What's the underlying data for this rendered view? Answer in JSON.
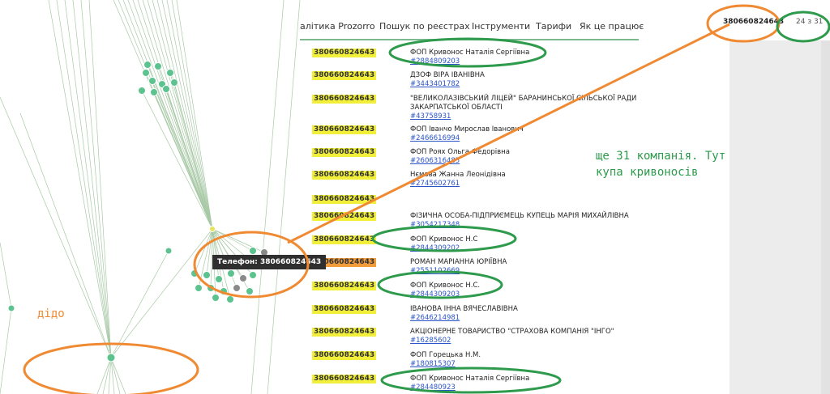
{
  "nav": {
    "items": [
      "алітика Prozorro",
      "Пошук по реєстрах",
      "Інструменти",
      "Тарифи",
      "Як це працює"
    ]
  },
  "header": {
    "phone": "380660824643",
    "counter": "24 з 31"
  },
  "tooltip": {
    "text": "Телефон: 380660824643"
  },
  "rows": [
    {
      "phone": "380660824643",
      "name": [
        "ФОП Кривонос Наталія Сергіївна"
      ],
      "link": "#2884809203",
      "highlight": "yellow"
    },
    {
      "phone": "380660824643",
      "name": [
        "ДЗОФ ВІРА ІВАНІВНА"
      ],
      "link": "#3443401782",
      "highlight": "yellow"
    },
    {
      "phone": "380660824643",
      "name": [
        "\"ВЕЛИКОЛАЗІВСЬКИЙ ЛІЦЕЙ\" БАРАНИНСЬКОЇ СІЛЬСЬКОЇ РАДИ",
        "ЗАКАРПАТСЬКОЇ ОБЛАСТІ"
      ],
      "link": "#43758931",
      "highlight": "yellow"
    },
    {
      "phone": "380660824643",
      "name": [
        "ФОП Іванчо Мирослав Іванович"
      ],
      "link": "#2466616994",
      "highlight": "yellow"
    },
    {
      "phone": "380660824643",
      "name": [
        "ФОП Роях Ольга Федорівна"
      ],
      "link": "#2606316485",
      "highlight": "yellow"
    },
    {
      "phone": "380660824643",
      "name": [
        "Нємова Жанна Леонідівна"
      ],
      "link": "#2745602761",
      "highlight": "yellow"
    },
    {
      "phone": "380660824643",
      "name": [],
      "link": "",
      "highlight": "yellow"
    },
    {
      "phone": "380660824643",
      "name": [
        "ФІЗИЧНА ОСОБА-ПІДПРИЄМЕЦЬ КУПЕЦЬ МАРІЯ МИХАЙЛІВНА"
      ],
      "link": "#3054217348",
      "highlight": "yellow"
    },
    {
      "phone": "380660824643",
      "name": [
        "ФОП Кривонос Н.С"
      ],
      "link": "#2844309202",
      "highlight": "yellow"
    },
    {
      "phone": "380660824643",
      "name": [
        "РОМАН МАРІАННА ЮРІЇВНА"
      ],
      "link": "#2551102669",
      "highlight": "orange"
    },
    {
      "phone": "380660824643",
      "name": [
        "ФОП Кривонос Н.С."
      ],
      "link": "#2844309203",
      "highlight": "yellow"
    },
    {
      "phone": "380660824643",
      "name": [
        "ІВАНОВА ІННА ВЯЧЕСЛАВІВНА"
      ],
      "link": "#2646214981",
      "highlight": "yellow"
    },
    {
      "phone": "380660824643",
      "name": [
        "АКЦІОНЕРНЕ ТОВАРИСТВО \"СТРАХОВА КОМПАНІЯ \"ІНГО\""
      ],
      "link": "#16285602",
      "highlight": "yellow"
    },
    {
      "phone": "380660824643",
      "name": [
        "ФОП Горецька Н.М."
      ],
      "link": "#180815307",
      "highlight": "yellow"
    },
    {
      "phone": "380660824643",
      "name": [
        "ФОП Кривонос Наталія Сергіївна"
      ],
      "link": "#284480923",
      "highlight": "yellow"
    }
  ],
  "annotations": {
    "note": "ще 31 компанія. Тут\nкупа кривоносів",
    "dido": "дідо"
  },
  "colors": {
    "green": "#2e9a4c",
    "orange": "#f08a32",
    "highlight_yellow": "#f2ef3b",
    "highlight_orange": "#f29b3b",
    "node": "#5cc38f",
    "link": "#2a54c8"
  }
}
